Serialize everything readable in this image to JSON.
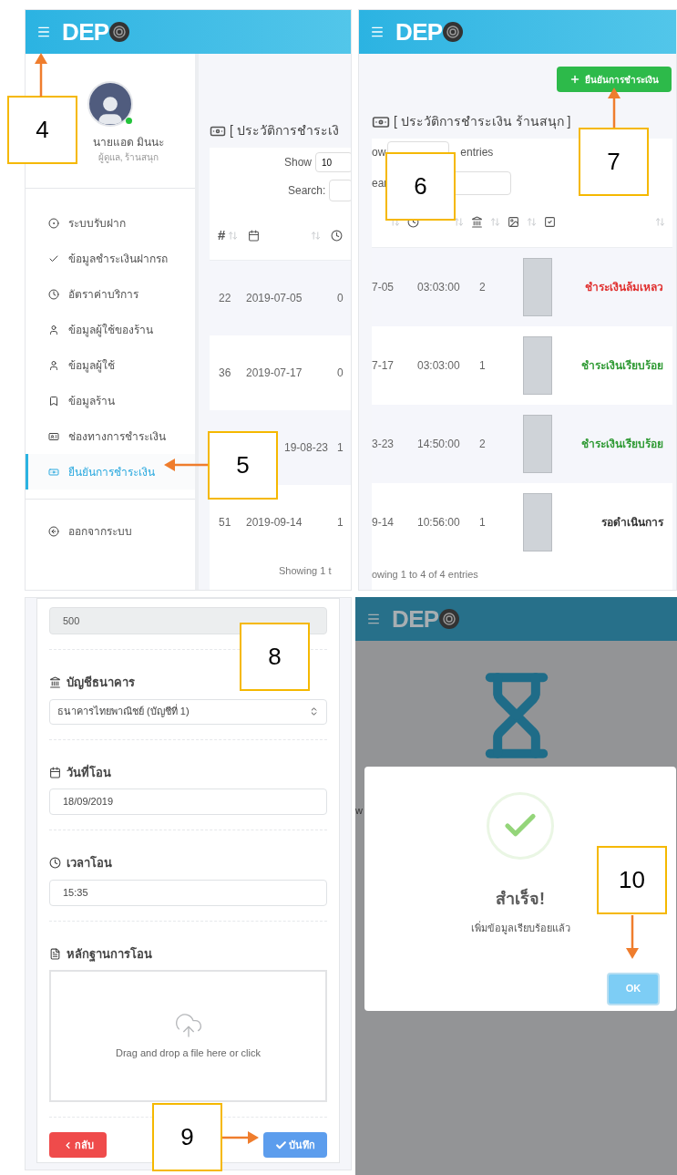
{
  "list_screen": {
    "logo": "DEP",
    "profile": {
      "name": "นายแอด มินนะ",
      "role": "ผู้ดูแล, ร้านสนุก",
      "online": true
    },
    "menu": [
      {
        "label": "ระบบรับฝาก",
        "selected": false
      },
      {
        "label": "ข้อมูลชำระเงินฝากรถ",
        "selected": false
      },
      {
        "label": "อัตราค่าบริการ",
        "selected": false
      },
      {
        "label": "ข้อมูลผู้ใช้ของร้าน",
        "selected": false
      },
      {
        "label": "ข้อมูลผู้ใช้",
        "selected": false
      },
      {
        "label": "ข้อมูลร้าน",
        "selected": false
      },
      {
        "label": "ช่องทางการชำระเงิน",
        "selected": false
      },
      {
        "label": "ยืนยันการชำระเงิน",
        "selected": true
      }
    ],
    "logout": "ออกจากระบบ",
    "title": "[ ประวัติการชำระเงิ",
    "show_label": "Show",
    "page_size": "10",
    "search_label": "Search:",
    "hash_column": "#",
    "rows": [
      {
        "number": "22",
        "date": "2019-07-05",
        "time": "0"
      },
      {
        "number": "36",
        "date": "2019-07-17",
        "time": "0"
      },
      {
        "date": "19-08-23",
        "time": "1"
      },
      {
        "number": "51",
        "date": "2019-09-14",
        "time": "1"
      }
    ],
    "footer": "Showing 1 t"
  },
  "history_screen": {
    "logo": "DEP",
    "confirm_button": "ยืนยันการชำระเงิน",
    "title": "[ ประวัติการชำระเงิน ร้านสนุก ]",
    "show_fragment": "ow",
    "entries_label": "entries",
    "search_fragment": "ear",
    "rows": [
      {
        "date": "7-05",
        "time": "03:03:00",
        "account": "2",
        "status": "ชำระเงินล้มเหลว",
        "kind": "failed"
      },
      {
        "date": "7-17",
        "time": "03:03:00",
        "account": "1",
        "status": "ชำระเงินเรียบร้อย",
        "kind": "success"
      },
      {
        "date": "3-23",
        "time": "14:50:00",
        "account": "2",
        "status": "ชำระเงินเรียบร้อย",
        "kind": "success"
      },
      {
        "date": "9-14",
        "time": "10:56:00",
        "account": "1",
        "status": "รอดำเนินการ",
        "kind": "pending"
      }
    ],
    "footer": "owing 1 to 4 of 4 entries"
  },
  "form_screen": {
    "amount": "500",
    "bank_label": "บัญชีธนาคาร",
    "bank_value": "ธนาคารไทยพาณิชย์ (บัญชีที่ 1)",
    "date_label": "วันที่โอน",
    "date_value": "18/09/2019",
    "time_label": "เวลาโอน",
    "time_value": "15:35",
    "proof_label": "หลักฐานการโอน",
    "dropzone": "Drag and drop a file here or click",
    "back_button": "กลับ",
    "save_button": "บันทึก"
  },
  "success_screen": {
    "logo": "DEP",
    "edge_fragment": "w",
    "dialog": {
      "title": "สำเร็จ!",
      "message": "เพิ่มข้อมูลเรียบร้อยแล้ว",
      "ok_button": "OK"
    }
  },
  "callouts": [
    {
      "number": "4"
    },
    {
      "number": "5"
    },
    {
      "number": "6"
    },
    {
      "number": "7"
    },
    {
      "number": "8"
    },
    {
      "number": "9"
    },
    {
      "number": "10"
    }
  ]
}
